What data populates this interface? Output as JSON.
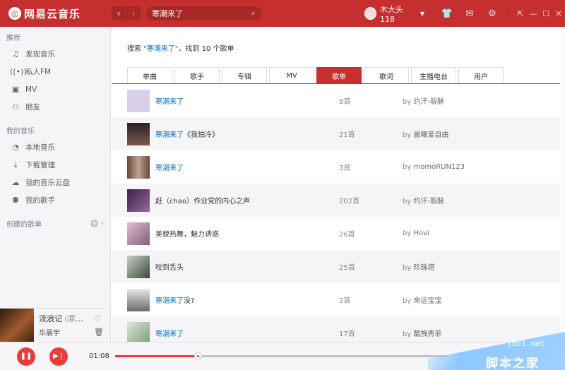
{
  "app": {
    "logo_text": "网易云音乐"
  },
  "topbar": {
    "back": "‹",
    "forward": "›",
    "search_value": "寒潮来了",
    "username": "木大头118",
    "icons": [
      "skin-icon",
      "mail-icon",
      "gear-icon"
    ],
    "window_icons": [
      "mini-mode-icon",
      "minimize-icon",
      "maximize-icon",
      "close-icon"
    ]
  },
  "sidebar": {
    "sections": [
      {
        "title": "推荐",
        "items": [
          {
            "label": "发现音乐",
            "icon": "music-note-icon"
          },
          {
            "label": "私人FM",
            "icon": "radio-icon"
          },
          {
            "label": "MV",
            "icon": "video-icon"
          },
          {
            "label": "朋友",
            "icon": "friends-icon"
          }
        ]
      },
      {
        "title": "我的音乐",
        "items": [
          {
            "label": "本地音乐",
            "icon": "local-music-icon"
          },
          {
            "label": "下载管理",
            "icon": "download-icon"
          },
          {
            "label": "我的音乐云盘",
            "icon": "cloud-icon"
          },
          {
            "label": "我的歌手",
            "icon": "singer-icon"
          }
        ]
      }
    ],
    "created_title": "创建的歌单"
  },
  "nowplaying": {
    "title": "流浪记",
    "subtitle": "(原唱...",
    "artist": "华晨宇"
  },
  "search_result": {
    "prefix": "搜索",
    "keyword": "\"寒潮来了\"",
    "suffix": "，找到 10 个歌单"
  },
  "tabs": [
    {
      "label": "单曲",
      "active": false
    },
    {
      "label": "歌手",
      "active": false
    },
    {
      "label": "专辑",
      "active": false
    },
    {
      "label": "MV",
      "active": false
    },
    {
      "label": "歌单",
      "active": true
    },
    {
      "label": "歌词",
      "active": false
    },
    {
      "label": "主播电台",
      "active": false
    },
    {
      "label": "用户",
      "active": false
    }
  ],
  "playlists": [
    {
      "name_hl": "寒潮来了",
      "name_rest": "",
      "count": "8首",
      "by": "by",
      "creator": "约汗-裂脉",
      "thumb_color": "#d9cfe6"
    },
    {
      "name_hl": "寒潮来了",
      "name_rest": "《我怕冷》",
      "count": "21首",
      "by": "by",
      "creator": "晨曦爱自由",
      "thumb_color": "#4a3a3a"
    },
    {
      "name_hl": "寒潮来了",
      "name_rest": "",
      "count": "3首",
      "by": "by",
      "creator": "momoRUN123",
      "thumb_color": "#8a6a5a"
    },
    {
      "name_hl": "",
      "name_rest": "赶（chao）作业党的内心之声",
      "count": "202首",
      "by": "by",
      "creator": "约汗-裂脉",
      "thumb_color": "#5a3a6a"
    },
    {
      "name_hl": "",
      "name_rest": "美貌热舞，魅力诱惑",
      "count": "26首",
      "by": "by",
      "creator": "Hovi",
      "thumb_color": "#b89ab0"
    },
    {
      "name_hl": "",
      "name_rest": "咬到舌头",
      "count": "25首",
      "by": "by",
      "creator": "珍珠塔",
      "thumb_color": "#6a7a6a"
    },
    {
      "name_hl": "寒潮来了",
      "name_rest": "没?",
      "count": "2首",
      "by": "by",
      "creator": "命运宝宝",
      "thumb_color": "#9a9a9a"
    },
    {
      "name_hl": "寒潮来了",
      "name_rest": "",
      "count": "17首",
      "by": "by",
      "creator": "酷拽秀菲",
      "thumb_color": "#a8c0a8"
    }
  ],
  "player": {
    "current_time": "01:08",
    "progress": 0.25
  },
  "watermark": {
    "url": "jb51.net",
    "text": "脚本之家"
  },
  "colors": {
    "brand_red": "#c62f2f",
    "link_blue": "#0c73c2",
    "player_red": "#e83c3c"
  }
}
